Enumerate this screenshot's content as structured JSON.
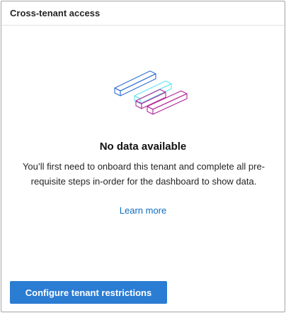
{
  "card": {
    "title": "Cross-tenant access"
  },
  "empty_state": {
    "illustration_icon": "isometric-bars-illustration-icon",
    "title": "No data available",
    "description": "You’ll first need to onboard this tenant and complete all pre-requisite steps in-order for the dashboard to show data.",
    "link_label": "Learn more"
  },
  "actions": {
    "primary_label": "Configure tenant restrictions"
  },
  "colors": {
    "accent": "#2b7cd3",
    "link": "#0f6cbd",
    "bar_blue": "#2f6fd1",
    "bar_cyan": "#5fe3f5",
    "bar_magenta": "#b5289a"
  }
}
